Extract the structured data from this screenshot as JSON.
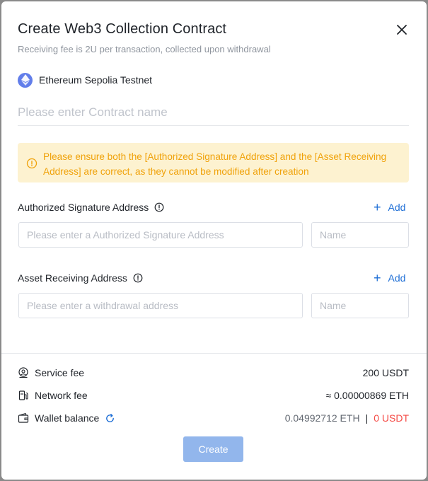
{
  "dialog": {
    "title": "Create Web3 Collection Contract",
    "subtitle": "Receiving fee is 2U per transaction, collected upon withdrawal",
    "close_icon": "close-icon"
  },
  "network": {
    "icon": "ethereum-icon",
    "name": "Ethereum Sepolia Testnet",
    "color": "#627eea"
  },
  "contract_name": {
    "value": "",
    "placeholder": "Please enter Contract name"
  },
  "warning": {
    "icon": "info-circle-icon",
    "text": "Please ensure both the [Authorized Signature Address] and the [Asset Receiving Address] are correct, as they cannot be modified after creation",
    "color": "#f0a20a",
    "background": "#fdf2d0"
  },
  "authorized_signature": {
    "label": "Authorized Signature Address",
    "add_label": "Add",
    "address_placeholder": "Please enter a Authorized Signature Address",
    "address_value": "",
    "name_placeholder": "Name",
    "name_value": ""
  },
  "asset_receiving": {
    "label": "Asset Receiving Address",
    "add_label": "Add",
    "address_placeholder": "Please enter a withdrawal address",
    "address_value": "",
    "name_placeholder": "Name",
    "name_value": ""
  },
  "fees": {
    "service_fee": {
      "label": "Service fee",
      "value": "200 USDT",
      "icon": "service-fee-icon"
    },
    "network_fee": {
      "label": "Network fee",
      "value": "≈ 0.00000869 ETH",
      "icon": "gas-pump-icon"
    },
    "wallet_balance": {
      "label": "Wallet balance",
      "icon": "wallet-icon",
      "refresh_icon": "refresh-icon",
      "eth": "0.04992712 ETH",
      "separator": "|",
      "usdt": "0 USDT"
    }
  },
  "actions": {
    "create_label": "Create",
    "primary_color": "#1f6fd6",
    "disabled_color": "#92b6ec"
  }
}
